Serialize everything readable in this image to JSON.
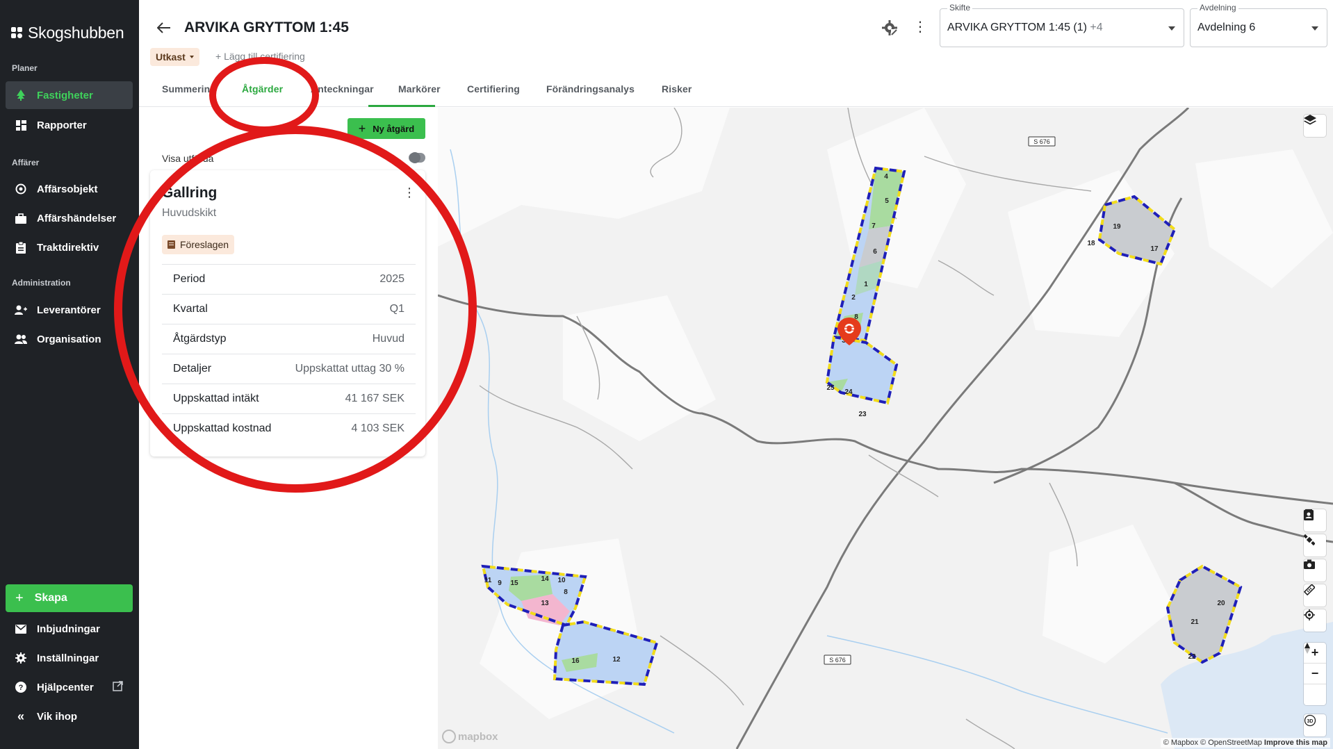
{
  "brand": {
    "name": "Skogshubben"
  },
  "sidebar": {
    "sections": [
      {
        "label": "Planer"
      },
      {
        "label": "Affärer"
      },
      {
        "label": "Administration"
      }
    ],
    "items": [
      {
        "label": "Fastigheter"
      },
      {
        "label": "Rapporter"
      },
      {
        "label": "Affärsobjekt"
      },
      {
        "label": "Affärshändelser"
      },
      {
        "label": "Traktdirektiv"
      },
      {
        "label": "Leverantörer"
      },
      {
        "label": "Organisation"
      }
    ],
    "create_label": "Skapa",
    "bottom": [
      {
        "label": "Inbjudningar"
      },
      {
        "label": "Inställningar"
      },
      {
        "label": "Hjälpcenter"
      },
      {
        "label": "Vik ihop"
      }
    ]
  },
  "header": {
    "title": "ARVIKA GRYTTOM 1:45",
    "status": "Utkast",
    "add_cert": "+ Lägg till certifiering",
    "skifte": {
      "label": "Skifte",
      "value": "ARVIKA GRYTTOM 1:45 (1)",
      "extra": "+4"
    },
    "avdelning": {
      "label": "Avdelning",
      "value": "Avdelning 6"
    }
  },
  "tabs": [
    {
      "label": "Summering"
    },
    {
      "label": "Åtgärder"
    },
    {
      "label": "Anteckningar"
    },
    {
      "label": "Markörer"
    },
    {
      "label": "Certifiering"
    },
    {
      "label": "Förändringsanalys"
    },
    {
      "label": "Risker"
    }
  ],
  "panel": {
    "new_button": "Ny åtgärd",
    "show_done": "Visa utförda",
    "card": {
      "title": "Gallring",
      "subtitle": "Huvudskikt",
      "badge": "Föreslagen",
      "rows": [
        {
          "key": "Period",
          "value": "2025"
        },
        {
          "key": "Kvartal",
          "value": "Q1"
        },
        {
          "key": "Åtgärdstyp",
          "value": "Huvud"
        },
        {
          "key": "Detaljer",
          "value": "Uppskattat uttag 30 %"
        },
        {
          "key": "Uppskattad intäkt",
          "value": "41 167 SEK"
        },
        {
          "key": "Uppskattad kostnad",
          "value": "4 103 SEK"
        }
      ]
    }
  },
  "map": {
    "road_labels": [
      "S 676",
      "S 676"
    ],
    "stand_numbers": [
      "4",
      "5",
      "7",
      "6",
      "1",
      "2",
      "8",
      "3",
      "25",
      "24",
      "23",
      "19",
      "18",
      "17",
      "11",
      "9",
      "15",
      "14",
      "10",
      "8",
      "13",
      "16",
      "12",
      "21",
      "20",
      "22"
    ],
    "logo": "mapbox",
    "attribution": "© Mapbox © OpenStreetMap",
    "attribution_link": "Improve this map",
    "zoom_in": "+",
    "zoom_out": "−",
    "pitch_label": "3D"
  },
  "colors": {
    "sidebar_bg": "#1f2226",
    "accent_green": "#3bbf4e",
    "annotation_red": "#e11919",
    "stand_border_blue": "#1f1fb8",
    "stand_border_yellow": "#f2dc1a"
  }
}
